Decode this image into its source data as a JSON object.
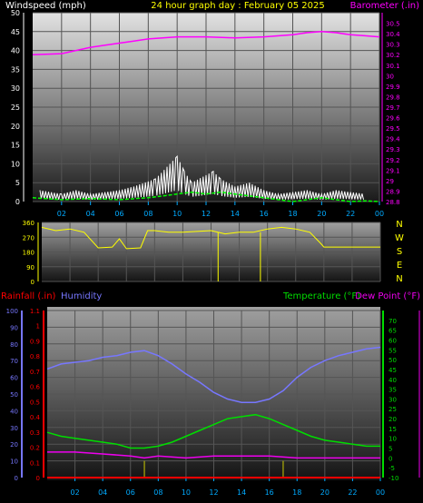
{
  "header": {
    "title": "24 hour graph day : February 05 2025",
    "left_label": "Windspeed (mph)",
    "right_label": "Barometer (.in)"
  },
  "colors": {
    "wind": "#ffffff",
    "gust": "#ffffff",
    "wind_avg": "#00ff00",
    "barometer": "#ff00ff",
    "direction": "#ffff00",
    "humidity": "#7777ff",
    "temperature": "#00dd00",
    "dewpoint": "#ee00ee",
    "rainfall": "#ff0000",
    "rain_bars": "#cccc00",
    "grid": "#555555",
    "hour_ticks": "#00aaff",
    "title": "#ffff00"
  },
  "chart_data": [
    {
      "type": "line",
      "name": "wind-barometer",
      "x_ticks": [
        "02",
        "04",
        "06",
        "08",
        "10",
        "12",
        "14",
        "16",
        "18",
        "20",
        "22",
        "00"
      ],
      "left_axis": {
        "label": "Windspeed (mph)",
        "ylim": [
          0,
          50
        ],
        "ticks": [
          0,
          5,
          10,
          15,
          20,
          25,
          30,
          35,
          40,
          45,
          50
        ]
      },
      "right_axis": {
        "label": "Barometer (.in)",
        "ylim": [
          28.8,
          30.6
        ],
        "ticks": [
          "28.8",
          "28.9",
          "29",
          "29.1",
          "29.2",
          "29.3",
          "29.4",
          "29.5",
          "29.6",
          "29.7",
          "29.8",
          "29.9",
          "30",
          "30.1",
          "30.2",
          "30.3",
          "30.4",
          "30.5"
        ]
      },
      "barometer": {
        "x": [
          0,
          2,
          3,
          4,
          6,
          7,
          8,
          10,
          12,
          14,
          16,
          18,
          19,
          20,
          21,
          22,
          23,
          24
        ],
        "y": [
          30.2,
          30.21,
          30.24,
          30.27,
          30.31,
          30.33,
          30.35,
          30.37,
          30.37,
          30.36,
          30.37,
          30.39,
          30.41,
          30.42,
          30.41,
          30.39,
          30.38,
          30.37
        ]
      },
      "wind_gust_peaks": {
        "x": [
          0.5,
          2,
          3,
          4,
          6,
          7,
          8.5,
          10,
          10.5,
          11,
          12.5,
          13,
          14,
          15,
          16,
          17,
          19,
          20,
          21,
          23
        ],
        "y": [
          3,
          2,
          3,
          2,
          3,
          4,
          6,
          12,
          8,
          5,
          8,
          6,
          4,
          5,
          3,
          2,
          3,
          2,
          3,
          2
        ]
      },
      "wind_avg": {
        "x": [
          0,
          2,
          4,
          6,
          8,
          9,
          10,
          11,
          12,
          13,
          14,
          15,
          16,
          17,
          18,
          19,
          20,
          21,
          22,
          23,
          24
        ],
        "y": [
          1,
          0.5,
          0.8,
          0.5,
          1,
          1.5,
          2,
          2.5,
          2,
          2.5,
          2,
          1.5,
          1,
          0.5,
          0,
          0.5,
          1,
          0.5,
          0,
          0.2,
          0
        ]
      }
    },
    {
      "type": "line",
      "name": "wind-direction",
      "y_ticks": [
        "360",
        "270",
        "180",
        "90",
        "0"
      ],
      "ylim": [
        0,
        360
      ],
      "compass": [
        "N",
        "W",
        "S",
        "E",
        "N"
      ],
      "direction": {
        "x": [
          0,
          1,
          2,
          3,
          4,
          5,
          5.5,
          6,
          7,
          7.5,
          8,
          9,
          10,
          11,
          12,
          13,
          14,
          15,
          16,
          17,
          18,
          19,
          19.8,
          20,
          21,
          22,
          23,
          24
        ],
        "y": [
          330,
          310,
          320,
          300,
          205,
          210,
          260,
          200,
          205,
          310,
          310,
          300,
          300,
          305,
          310,
          290,
          300,
          300,
          320,
          330,
          320,
          300,
          230,
          210,
          210,
          210,
          210,
          210
        ]
      }
    },
    {
      "type": "line",
      "name": "humidity-temperature-rain",
      "labels": {
        "rainfall": "Rainfall (.in)",
        "humidity": "Humidity",
        "temperature": "Temperature (°F)",
        "dewpoint": "Dew Point (°F)"
      },
      "humidity_axis": {
        "ylim": [
          0,
          100
        ],
        "ticks": [
          "0",
          "10",
          "20",
          "30",
          "40",
          "50",
          "60",
          "70",
          "80",
          "90",
          "100"
        ]
      },
      "rainfall_axis": {
        "ylim": [
          0,
          1.1
        ],
        "ticks": [
          "0",
          "0.1",
          "0.2",
          "0.3",
          "0.4",
          "0.5",
          "0.6",
          "0.7",
          "0.8",
          "0.9",
          "1",
          "1.1"
        ]
      },
      "temperature_axis": {
        "ylim": [
          -10,
          75
        ],
        "ticks": [
          "-10",
          "-5",
          "0",
          "5",
          "10",
          "15",
          "20",
          "25",
          "30",
          "35",
          "40",
          "45",
          "50",
          "55",
          "60",
          "65",
          "70"
        ]
      },
      "humidity": {
        "x": [
          0,
          1,
          2,
          3,
          4,
          5,
          6,
          7,
          8,
          9,
          10,
          11,
          12,
          13,
          14,
          15,
          16,
          17,
          18,
          19,
          20,
          21,
          22,
          23,
          24
        ],
        "y": [
          65,
          68,
          69,
          70,
          72,
          73,
          75,
          76,
          73,
          68,
          62,
          57,
          51,
          47,
          45,
          45,
          47,
          52,
          60,
          66,
          70,
          73,
          75,
          77,
          78
        ]
      },
      "temperature": {
        "x": [
          0,
          1,
          2,
          3,
          4,
          5,
          6,
          7,
          8,
          9,
          10,
          11,
          12,
          13,
          14,
          15,
          16,
          17,
          18,
          19,
          20,
          21,
          22,
          23,
          24
        ],
        "y": [
          13,
          11,
          10,
          9,
          8,
          7,
          5,
          5,
          6,
          8,
          11,
          14,
          17,
          20,
          21,
          22,
          20,
          17,
          14,
          11,
          9,
          8,
          7,
          6,
          6
        ]
      },
      "dewpoint": {
        "x": [
          0,
          2,
          4,
          6,
          7,
          8,
          10,
          12,
          14,
          16,
          18,
          20,
          22,
          24
        ],
        "y": [
          3,
          3,
          2,
          1,
          0,
          1,
          0,
          1,
          1,
          1,
          0,
          0,
          0,
          0
        ]
      },
      "rainfall": {
        "x": [
          0,
          24
        ],
        "y": [
          0,
          0
        ]
      },
      "rain_events": {
        "x": [
          7,
          17
        ],
        "y": [
          0.05,
          0.05
        ]
      }
    }
  ]
}
